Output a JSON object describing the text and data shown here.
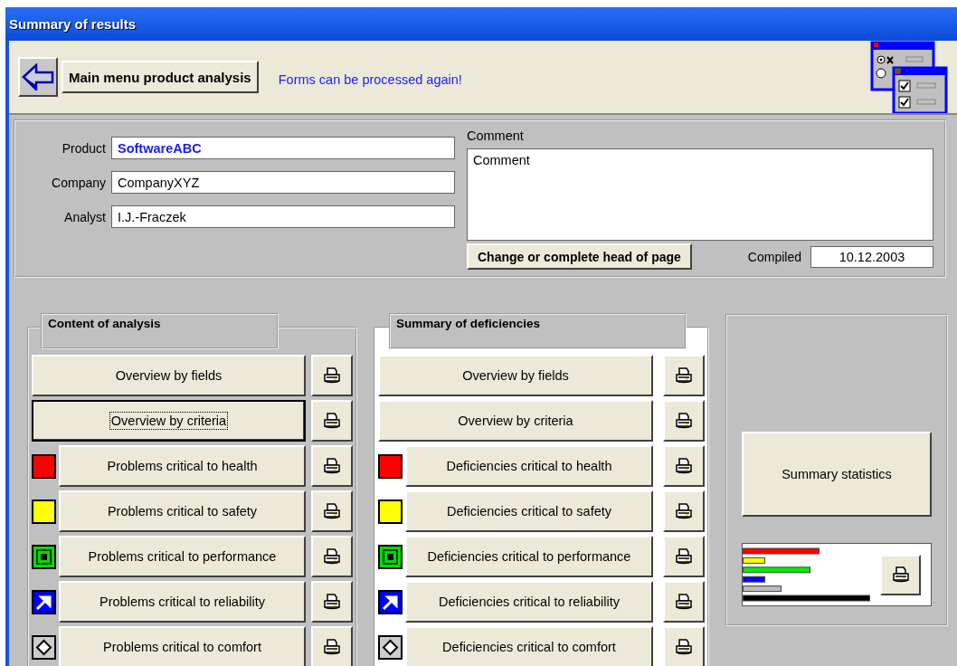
{
  "window": {
    "title": "Summary of results"
  },
  "toolbar": {
    "main_menu_button": "Main menu product analysis",
    "status_message": "Forms can be processed again!"
  },
  "header": {
    "fields": [
      {
        "label": "Product",
        "value": "SoftwareABC",
        "emphasized": true
      },
      {
        "label": "Company",
        "value": "CompanyXYZ",
        "emphasized": false
      },
      {
        "label": "Analyst",
        "value": "I.J.-Fraczek",
        "emphasized": false
      }
    ],
    "comment": {
      "label": "Comment",
      "value": "Comment"
    },
    "change_button": "Change or complete head of page",
    "compiled": {
      "label": "Compiled",
      "value": "10.12.2003"
    }
  },
  "content_of_analysis": {
    "title": "Content of analysis",
    "items": [
      {
        "label": "Overview by fields",
        "kind": "overview",
        "focused": false
      },
      {
        "label": "Overview by criteria",
        "kind": "overview",
        "focused": true
      },
      {
        "label": "Problems critical to health",
        "kind": "health",
        "focused": false
      },
      {
        "label": "Problems critical to safety",
        "kind": "safety",
        "focused": false
      },
      {
        "label": "Problems critical to performance",
        "kind": "performance",
        "focused": false
      },
      {
        "label": "Problems critical to reliability",
        "kind": "reliability",
        "focused": false
      },
      {
        "label": "Problems critical to comfort",
        "kind": "comfort",
        "focused": false
      }
    ]
  },
  "summary_of_deficiencies": {
    "title": "Summary of deficiencies",
    "items": [
      {
        "label": "Overview by fields",
        "kind": "overview",
        "focused": false
      },
      {
        "label": "Overview by criteria",
        "kind": "overview",
        "focused": false
      },
      {
        "label": "Deficiencies critical to health",
        "kind": "health",
        "focused": false
      },
      {
        "label": "Deficiencies critical to safety",
        "kind": "safety",
        "focused": false
      },
      {
        "label": "Deficiencies critical to performance",
        "kind": "performance",
        "focused": false
      },
      {
        "label": "Deficiencies critical to reliability",
        "kind": "reliability",
        "focused": false
      },
      {
        "label": "Deficiencies critical to comfort",
        "kind": "comfort",
        "focused": false
      }
    ]
  },
  "statistics": {
    "button": "Summary statistics"
  }
}
